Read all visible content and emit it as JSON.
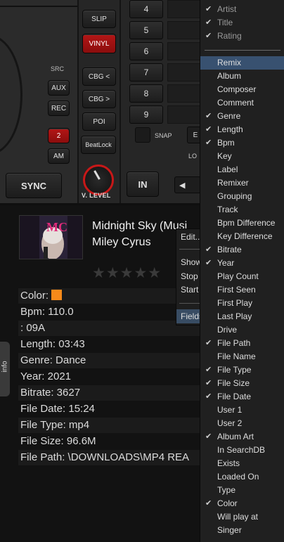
{
  "deck": {
    "buttons": {
      "slip": "SLIP",
      "vinyl": "VINYL",
      "src_label": "SRC",
      "aux": "AUX",
      "rec": "REC",
      "cbg_left": "CBG <",
      "cbg_right": "CBG >",
      "poi": "POI",
      "beatlock": "BeatLock",
      "two": "2",
      "am": "AM",
      "sync": "SYNC",
      "in": "IN",
      "v_level": "V. LEVEL",
      "snap": "SNAP",
      "e": "E",
      "lo": "LO",
      "nav_left": "◀"
    },
    "cue_numbers": [
      "4",
      "5",
      "6",
      "7",
      "8",
      "9"
    ]
  },
  "info": {
    "tab_label": "info",
    "title": "Midnight Sky (Musi",
    "artist": "Miley Cyrus",
    "stars": "★★★★★",
    "color_label": "Color:",
    "color_value": "#f78a1a",
    "fields": [
      "Bpm: 110.0",
      ": 09A",
      "Length: 03:43",
      "Genre: Dance",
      "Year: 2021",
      "Bitrate: 3627",
      "File Date: 15:24",
      "File Type: mp4",
      "File Size: 96.6M",
      "File Path: \\DOWNLOADS\\MP4 REA"
    ],
    "cover_text": "MC"
  },
  "submenu": {
    "items": [
      "Edit...",
      "Show",
      "Stop",
      "Start",
      "Fields"
    ]
  },
  "menu": {
    "items": [
      {
        "label": "Artist",
        "checked": true,
        "dim": true
      },
      {
        "label": "Title",
        "checked": true,
        "dim": true
      },
      {
        "label": "Rating",
        "checked": true,
        "dim": true
      },
      {
        "label": "Remix",
        "checked": false,
        "active": true
      },
      {
        "label": "Album",
        "checked": false
      },
      {
        "label": "Composer",
        "checked": false
      },
      {
        "label": "Comment",
        "checked": false
      },
      {
        "label": "Genre",
        "checked": true
      },
      {
        "label": "Length",
        "checked": true
      },
      {
        "label": "Bpm",
        "checked": true
      },
      {
        "label": "Key",
        "checked": false
      },
      {
        "label": "Label",
        "checked": false
      },
      {
        "label": "Remixer",
        "checked": false
      },
      {
        "label": "Grouping",
        "checked": false
      },
      {
        "label": "Track",
        "checked": false
      },
      {
        "label": "Bpm Difference",
        "checked": false
      },
      {
        "label": "Key Difference",
        "checked": false
      },
      {
        "label": "Bitrate",
        "checked": true
      },
      {
        "label": "Year",
        "checked": true
      },
      {
        "label": "Play Count",
        "checked": false
      },
      {
        "label": "First Seen",
        "checked": false
      },
      {
        "label": "First Play",
        "checked": false
      },
      {
        "label": "Last Play",
        "checked": false
      },
      {
        "label": "Drive",
        "checked": false
      },
      {
        "label": "File Path",
        "checked": true
      },
      {
        "label": "File Name",
        "checked": false
      },
      {
        "label": "File Type",
        "checked": true
      },
      {
        "label": "File Size",
        "checked": true
      },
      {
        "label": "File Date",
        "checked": true
      },
      {
        "label": "User 1",
        "checked": false
      },
      {
        "label": "User 2",
        "checked": false
      },
      {
        "label": "Album Art",
        "checked": true
      },
      {
        "label": "In SearchDB",
        "checked": false
      },
      {
        "label": "Exists",
        "checked": false
      },
      {
        "label": "Loaded On",
        "checked": false
      },
      {
        "label": "Type",
        "checked": false
      },
      {
        "label": "Color",
        "checked": true
      },
      {
        "label": "Will play at",
        "checked": false
      },
      {
        "label": "Singer",
        "checked": false
      }
    ],
    "check_glyph": "✔"
  },
  "colors": {
    "accent_red": "#c81818",
    "menu_highlight": "#385170",
    "swatch_orange": "#f78a1a"
  }
}
